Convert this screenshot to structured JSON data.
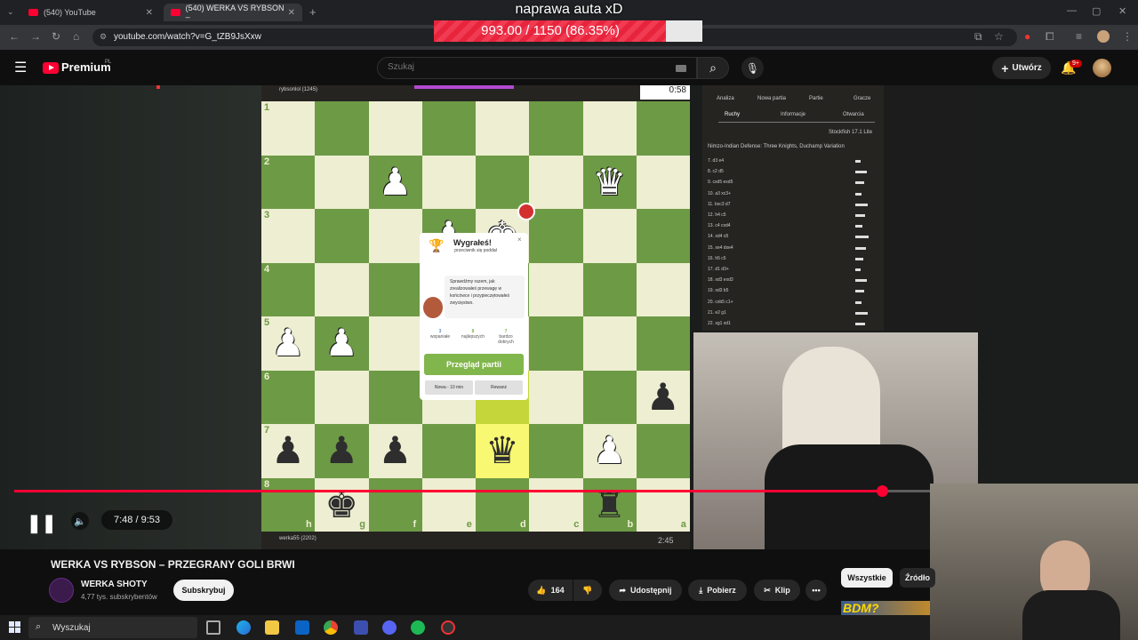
{
  "browser": {
    "tabs": [
      {
        "label": "(540) YouTube"
      },
      {
        "label": "(540) WERKA VS RYBSON –"
      }
    ],
    "url": "youtube.com/watch?v=G_tZB9JsXxw"
  },
  "stream_overlay": {
    "title": "naprawa auta xD",
    "progress_text": "993.00 / 1150 (86.35%)",
    "progress_fraction": 0.8635
  },
  "youtube": {
    "logo": "Premium",
    "logo_region": "PL",
    "search_placeholder": "Szukaj",
    "create_label": "Utwórz",
    "notif_badge": "9+"
  },
  "chess": {
    "timer_top": "0:58",
    "timer_bottom": "2:45",
    "player_top": "rybsonlol (1245)",
    "player_bottom": "werka55 (2202)",
    "ranks": [
      "1",
      "2",
      "3",
      "4",
      "5",
      "6",
      "7",
      "8"
    ],
    "files": [
      "h",
      "g",
      "f",
      "e",
      "d",
      "c",
      "b",
      "a"
    ],
    "popup": {
      "title": "Wygrałeś!",
      "subtitle": "przeciwnik się poddał",
      "message": "Sprawdźmy razem, jak zrealizowałeś przewagę w końcówce i przypieczętowałeś zwycięstwo.",
      "stats": [
        {
          "value": "3",
          "label": "wspaniałe"
        },
        {
          "value": "8",
          "label": "najlepszych"
        },
        {
          "value": "7",
          "label": "bardzo dobrych"
        }
      ],
      "review_label": "Przegląd partii",
      "new_game_label": "Nowa - 10 min",
      "rematch_label": "Rewanż"
    },
    "analysis": {
      "tabs": [
        "Analiza",
        "Nowa partia",
        "Partie",
        "Gracze"
      ],
      "subtabs": [
        "Ruchy",
        "Informacje",
        "Otwarcia"
      ],
      "opening": "Nimzo-Indian Defense: Three Knights, Duchamp Variation",
      "engine": "Stockfish 17.1 Lite",
      "moves": [
        "7. d3 e4",
        "8. c2 d5",
        "9. cxd5 exd5",
        "10. a3 xc3+",
        "11. bxc3 d7",
        "12. h4 c5",
        "13. c4 cxd4",
        "14. xd4 c8",
        "15. xe4 dxe4",
        "16. h5 c5",
        "17. d1 d3+",
        "18. xd3 exd3",
        "19. xd3 b5",
        "20. cxb5 c1+",
        "21. e2 g1",
        "22. xg1 xd1"
      ]
    }
  },
  "player": {
    "time": "7:48 / 9:53",
    "progress_fraction": 0.786
  },
  "video": {
    "title": "WERKA VS RYBSON – PRZEGRANY GOLI BRWI",
    "channel": "WERKA SHOTY",
    "subscribers": "4,77 tys. subskrybentów",
    "subscribe_label": "Subskrybuj",
    "likes": "164",
    "share_label": "Udostępnij",
    "download_label": "Pobierz",
    "clip_label": "Klip",
    "more_label": "•••"
  },
  "related_chips": [
    "Wszystkie",
    "Źródło"
  ],
  "thumb_text": "BDM?",
  "taskbar": {
    "search_label": "Wyszukaj"
  },
  "icons": {
    "menu": "hamburger-icon",
    "search": "search-icon",
    "mic": "mic-icon",
    "bell": "bell-icon",
    "like": "thumbs-up-icon",
    "dislike": "thumbs-down-icon",
    "share": "share-arrow-icon",
    "download": "download-icon",
    "clip": "scissors-icon"
  },
  "colors": {
    "youtube_red": "#ff0033",
    "chess_green": "#81b64c",
    "board_dark": "#6d9a45",
    "board_light": "#eeeed2"
  }
}
